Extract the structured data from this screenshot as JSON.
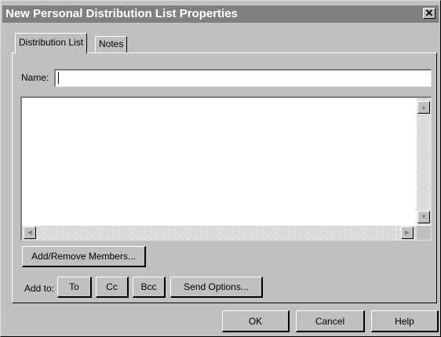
{
  "window": {
    "title": "New Personal Distribution List Properties",
    "close_glyph": "✕"
  },
  "tabs": [
    {
      "label": "Distribution List",
      "active": true
    },
    {
      "label": "Notes",
      "active": false
    }
  ],
  "name_field": {
    "label": "Name:",
    "value": ""
  },
  "members_list": {
    "items": [],
    "scroll_up_glyph": "▲",
    "scroll_down_glyph": "▼",
    "scroll_left_glyph": "◀",
    "scroll_right_glyph": "▶"
  },
  "buttons": {
    "add_remove_members": "Add/Remove Members...",
    "to": "To",
    "cc": "Cc",
    "bcc": "Bcc",
    "send_options": "Send Options...",
    "ok": "OK",
    "cancel": "Cancel",
    "help": "Help"
  },
  "add_to_label": "Add to:",
  "colors": {
    "face": "#c0c0c0",
    "title_inactive": "#808080",
    "field_bg": "#ffffff"
  }
}
